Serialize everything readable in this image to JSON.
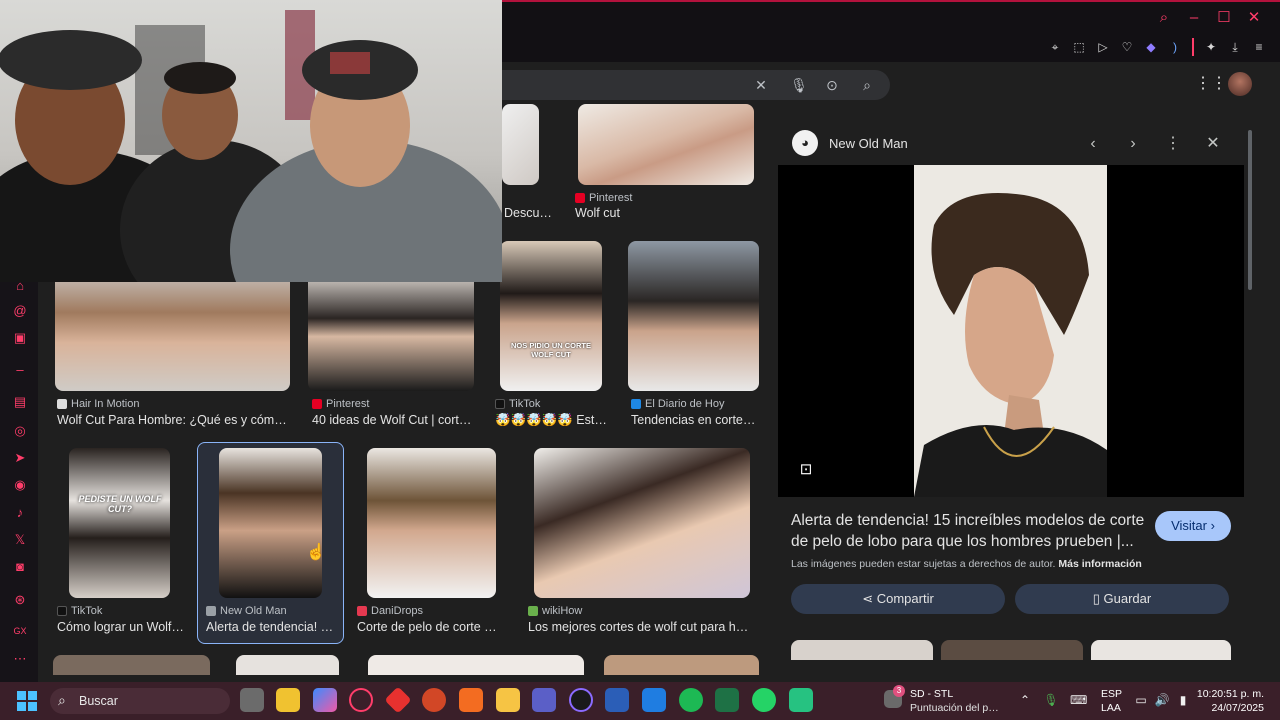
{
  "colors": {
    "accent": "#ff3d6a",
    "google_blue_btn": "#a8c7fa",
    "panel_btn": "#303b4f",
    "taskbar": "#3a1f29"
  },
  "browser": {
    "window_controls": [
      "search-icon",
      "minimize-icon",
      "maximize-icon",
      "close-icon"
    ],
    "toolbar_icons": [
      "pin-icon",
      "snapshot-icon",
      "play-icon",
      "heart-icon",
      "aria-icon",
      "wifi-icon",
      "extensions-icon",
      "download-icon",
      "menu-icon"
    ]
  },
  "sidebar_icons": [
    "home-icon",
    "threads-icon",
    "tv-icon",
    "twitch-icon",
    "whatsapp-icon",
    "telegram-icon",
    "instagram-icon",
    "tiktok-icon",
    "x-icon",
    "discord-icon",
    "opera-gx-icon",
    "gx-icon",
    "more-icon"
  ],
  "search": {
    "icons": [
      "clear-icon",
      "mic-icon",
      "lens-icon",
      "search-icon"
    ]
  },
  "results": [
    {
      "source": "",
      "caption": "Descu…"
    },
    {
      "source": "Pinterest",
      "caption": "Wolf cut"
    },
    {
      "source": "Hair In Motion",
      "caption": "Wolf Cut Para Hombre: ¿Qué es y cómo …"
    },
    {
      "source": "Pinterest",
      "caption": "40 ideas de Wolf Cut | cort…"
    },
    {
      "source": "TikTok",
      "caption": "🤯🤯🤯🤯🤯 Est…",
      "overlay": "NOS PIDIO UN CORTE WOLF CUT"
    },
    {
      "source": "El Diario de Hoy",
      "caption": "Tendencias en corte…"
    },
    {
      "source": "TikTok",
      "caption": "Cómo lograr un Wolf …",
      "overlay": "PEDISTE UN WOLF CUT?"
    },
    {
      "source": "New Old Man",
      "caption": "Alerta de tendencia! …"
    },
    {
      "source": "DaniDrops",
      "caption": "Corte de pelo de corte d…"
    },
    {
      "source": "wikiHow",
      "caption": "Los mejores cortes de wolf cut para ho…"
    }
  ],
  "panel": {
    "source": "New Old Man",
    "title": "Alerta de tendencia! 15 increíbles modelos de corte de pelo de lobo para que los hombres prueben |...",
    "visit": "Visitar",
    "copyright": "Las imágenes pueden estar sujetas a derechos de autor.",
    "more_info": "Más información",
    "share": "Compartir",
    "save": "Guardar"
  },
  "taskbar": {
    "search_placeholder": "Buscar",
    "notif_count": "3",
    "game_title": "SD - STL",
    "game_sub": "Puntuación del p…",
    "lang": "ESP",
    "region": "LAA",
    "time": "10:20:51 p. m.",
    "date": "24/07/2025"
  }
}
